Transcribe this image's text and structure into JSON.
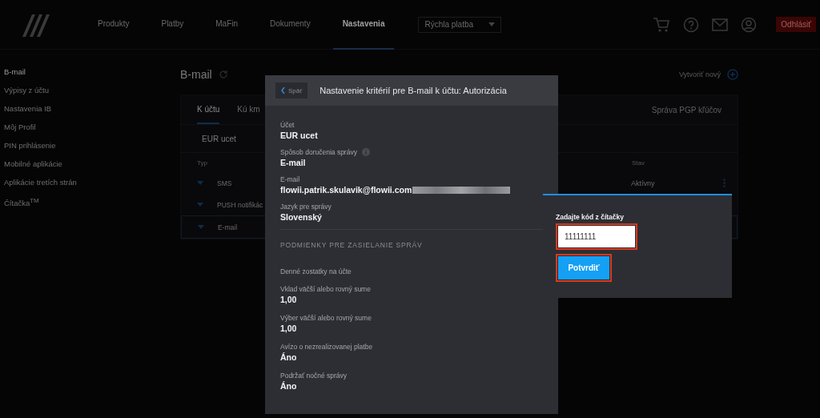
{
  "header": {
    "nav": [
      {
        "label": "Produkty",
        "selected": false
      },
      {
        "label": "Platby",
        "selected": false
      },
      {
        "label": "MaFin",
        "selected": false
      },
      {
        "label": "Dokumenty",
        "selected": false
      },
      {
        "label": "Nastavenia",
        "selected": true
      }
    ],
    "quick_pay": {
      "value": "Rýchla platba"
    },
    "logout": "Odhlásiť"
  },
  "sidebar": {
    "items": [
      {
        "label": "B-mail",
        "selected": true
      },
      {
        "label": "Výpisy z účtu",
        "selected": false
      },
      {
        "label": "Nastavenia IB",
        "selected": false
      },
      {
        "label": "Môj Profil",
        "selected": false
      },
      {
        "label": "PIN prihlásenie",
        "selected": false
      },
      {
        "label": "Mobilné aplikácie",
        "selected": false
      },
      {
        "label": "Aplikácie tretích strán",
        "selected": false
      },
      {
        "label": "Čítačka$^{TM}$",
        "selected": false
      }
    ]
  },
  "page": {
    "title": "B-mail",
    "create_link": "Vytvoriť nový",
    "tabs": [
      {
        "label": "K účtu",
        "selected": true
      },
      {
        "label": "Kú km",
        "selected": false
      }
    ],
    "pgp_button": "Správa PGP kľúčov",
    "account": "EUR ucet",
    "columns": [
      "Typ",
      "Stav"
    ],
    "rows": [
      {
        "type": "SMS",
        "status": "Aktívny",
        "selected": false
      },
      {
        "type": "PUSH notifikác",
        "selected": false
      },
      {
        "type": "E-mail",
        "selected": true
      }
    ]
  },
  "modal": {
    "back_button": "Späť",
    "title": "Nastavenie kritérií pre B-mail k účtu: Autorizácia",
    "fields": [
      {
        "label": "Účet",
        "value": "EUR ucet",
        "info": false,
        "redacted": false
      },
      {
        "label": "Spôsob doručenia správy",
        "value": "E-mail",
        "info": true,
        "redacted": false
      },
      {
        "label": "E-mail",
        "value": "flowii.patrik.skulavik@flowii.com",
        "info": false,
        "redacted": true
      },
      {
        "label": "Jazyk pre správy",
        "value": "Slovenský",
        "info": false,
        "redacted": false
      }
    ],
    "section_title": "PODMIENKY PRE ZASIELANIE SPRÁV",
    "conditions": [
      {
        "label": "Denné zostatky na účte"
      },
      {
        "label": "Vklad väčší alebo rovný sume",
        "value": "1,00"
      },
      {
        "label": "Výber väčší alebo rovný sume",
        "value": "1,00"
      },
      {
        "label": "Avízo o nezrealizovanej platbe",
        "value": "Áno"
      },
      {
        "label": "Podržať nočné správy",
        "value": "Áno"
      }
    ]
  },
  "auth_popup": {
    "label": "Zadajte kód z čítačky",
    "code": {
      "value": "11111111",
      "highlighted": true
    },
    "confirm": {
      "label": "Potvrdiť",
      "highlighted": true
    }
  }
}
